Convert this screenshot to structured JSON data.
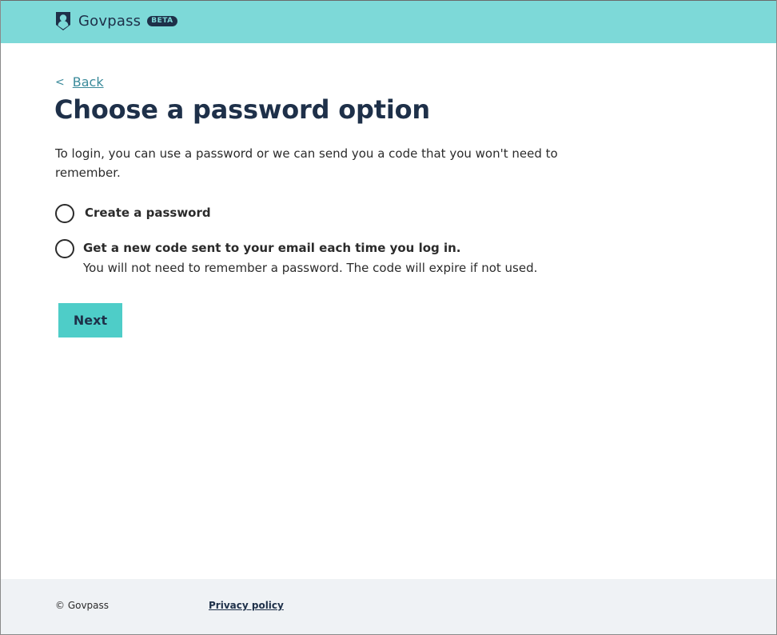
{
  "header": {
    "brand_name": "Govpass",
    "beta_badge": "BETA",
    "logo_icon": "shield-person-icon",
    "background_color": "#7dd9d8",
    "brand_color": "#1e3049"
  },
  "back_link": {
    "chevron": "<",
    "label": "Back"
  },
  "main": {
    "title": "Choose a password option",
    "intro": "To login, you can use a password or we can send you a code that you won't need to remember.",
    "options": [
      {
        "label": "Create a password",
        "hint": "",
        "selected": false
      },
      {
        "label": "Get a new code sent to your email each time you log in.",
        "hint": "You will not need to remember a password. The code will expire if not used.",
        "selected": false
      }
    ],
    "next_button": "Next",
    "button_color": "#4ecdc8"
  },
  "footer": {
    "copyright": "© Govpass",
    "privacy_link": "Privacy policy",
    "background_color": "#eff2f5"
  }
}
